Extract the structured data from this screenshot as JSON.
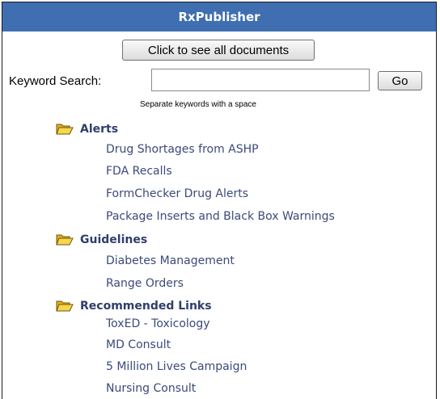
{
  "app": {
    "title": "RxPublisher"
  },
  "toolbar": {
    "all_docs_label": "Click to see all documents",
    "keyword_label": "Keyword Search:",
    "keyword_value": "",
    "go_label": "Go",
    "hint": "Separate keywords with a space"
  },
  "sections": [
    {
      "title": "Alerts",
      "icon": "folder-open-icon",
      "links": [
        "Drug Shortages from ASHP",
        "FDA Recalls",
        "FormChecker Drug Alerts",
        "Package Inserts and Black Box Warnings"
      ]
    },
    {
      "title": "Guidelines",
      "icon": "folder-open-icon",
      "links": [
        "Diabetes Management",
        "Range Orders"
      ]
    },
    {
      "title": "Recommended Links",
      "icon": "folder-open-icon",
      "links": [
        "ToxED - Toxicology",
        "MD Consult",
        "5 Million Lives Campaign",
        "Nursing Consult"
      ]
    }
  ],
  "colors": {
    "titlebar": "#3f6fb0",
    "section_title": "#2f3e6b",
    "link": "#3b4a7a",
    "folder": "#f0c419"
  }
}
